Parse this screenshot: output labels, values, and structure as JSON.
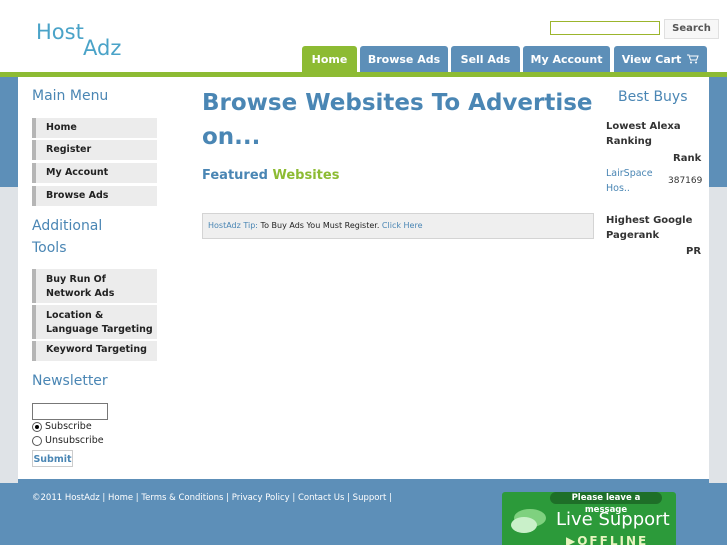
{
  "header": {
    "logo_line1": "Host",
    "logo_line2": "Adz",
    "search_button": "Search",
    "search_value": ""
  },
  "tabs": [
    {
      "label": "Home",
      "active": true
    },
    {
      "label": "Browse Ads"
    },
    {
      "label": "Sell Ads"
    },
    {
      "label": "My Account"
    },
    {
      "label": "View Cart"
    }
  ],
  "sidebar": {
    "main_menu_title": "Main Menu",
    "main_items": [
      "Home",
      "Register",
      "My Account",
      "Browse Ads"
    ],
    "tools_title_1": "Additional",
    "tools_title_2": "Tools",
    "tools_items": [
      "Buy Run Of Network Ads",
      "Location & Language Targeting",
      "Keyword Targeting"
    ],
    "newsletter_title": "Newsletter",
    "subscribe_label": "Subscribe",
    "unsubscribe_label": "Unsubscribe",
    "submit_label": "Submit"
  },
  "main": {
    "title": "Browse Websites To Advertise on...",
    "featured_prefix": "Featured ",
    "featured_highlight": "Websites",
    "tip_label": "HostAdz Tip:",
    "tip_text": " To Buy Ads You Must Register. ",
    "tip_link": "Click Here"
  },
  "best_buys": {
    "title": "Best Buys",
    "alexa_heading": "Lowest Alexa Ranking",
    "alexa_col": "Rank",
    "alexa_site": "LairSpace Hos..",
    "alexa_value": "387169",
    "google_heading": "Highest Google Pagerank",
    "google_col": "PR"
  },
  "footer": {
    "copyright": "©2011 HostAdz",
    "links": [
      "Home",
      "Terms & Conditions",
      "Privacy Policy",
      "Contact Us",
      "Support"
    ]
  },
  "live_support": {
    "message": "Please leave a message",
    "title": "Live Support",
    "status": "OFFLINE"
  },
  "colors": {
    "accent_blue": "#4a86b4",
    "accent_green": "#8dbb33",
    "tab_blue": "#5d8fb8"
  }
}
